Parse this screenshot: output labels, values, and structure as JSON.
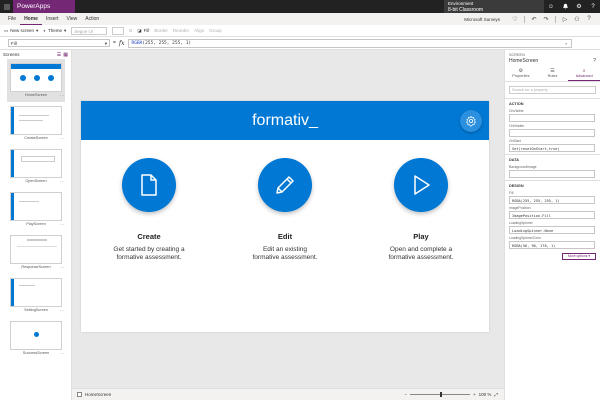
{
  "titlebar": {
    "app_name": "PowerApps",
    "env_label": "Environment",
    "env_name": "8-bit Classroom",
    "icons": [
      "smiley-icon",
      "bell-icon",
      "gear-icon",
      "help-icon"
    ],
    "icon_glyphs": [
      "☺",
      "🔔",
      "⚙",
      "?"
    ]
  },
  "menubar": {
    "items": [
      "File",
      "Home",
      "Insert",
      "View",
      "Action"
    ],
    "active": "Home",
    "user": "Microsoft Surveys"
  },
  "ribbon": {
    "new_screen": "New screen",
    "theme": "Theme",
    "font_placeholder": "Segoe UI",
    "font_size": "",
    "bold": "B",
    "fill": "Fill",
    "dim_items": [
      "Border",
      "Reorder",
      "Align",
      "Group"
    ]
  },
  "formulabar": {
    "property": "Fill",
    "equals": "=",
    "fx": "fx",
    "formula_fn": "RGBA",
    "formula_args": "(255, 255, 255, 1)"
  },
  "leftpanel": {
    "title": "Screens",
    "screens": [
      {
        "name": "HomeScreen"
      },
      {
        "name": "CreateScreen"
      },
      {
        "name": "OpenScreen"
      },
      {
        "name": "PlayScreen"
      },
      {
        "name": "ResponseScreen"
      },
      {
        "name": "SettingScreen"
      },
      {
        "name": "SuccessScreen"
      }
    ]
  },
  "app": {
    "title": "formativ_",
    "actions": [
      {
        "title": "Create",
        "desc1": "Get started by creating a",
        "desc2": "formative assessment."
      },
      {
        "title": "Edit",
        "desc1": "Edit an existing",
        "desc2": "formative assessment."
      },
      {
        "title": "Play",
        "desc1": "Open and complete a",
        "desc2": "formative assessment."
      }
    ],
    "colors": {
      "header": "#0078d4",
      "accent": "#742774"
    }
  },
  "statusbar": {
    "screen_name": "HomeScreen",
    "zoom": "100 %"
  },
  "rightpanel": {
    "type": "SCREEN",
    "name": "HomeScreen",
    "tabs": [
      "Properties",
      "Rules",
      "Advanced"
    ],
    "active_tab": "Advanced",
    "search_placeholder": "Search for a property",
    "sections": {
      "action": "ACTION",
      "data": "DATA",
      "design": "DESIGN"
    },
    "fields": {
      "onvisible_label": "OnVisible",
      "onvisible_value": "",
      "onhidden_label": "OnHidden",
      "onhidden_value": "",
      "onstart_label": "OnStart",
      "onstart_value": "Set(resetOnStart,true)",
      "bgimage_label": "BackgroundImage",
      "bgimage_value": "",
      "fill_label": "Fill",
      "fill_value": "RGBA(255, 255, 255, 1)",
      "imagepos_label": "ImagePosition",
      "imagepos_value": "ImagePosition.Fill",
      "loadingspinner_label": "LoadingSpinner",
      "loadingspinner_value": "LoadingSpinner.None",
      "spinnercolor_label": "LoadingSpinnerColor",
      "spinnercolor_value": "RGBA(56, 96, 178, 1)"
    },
    "more_options": "More options"
  }
}
